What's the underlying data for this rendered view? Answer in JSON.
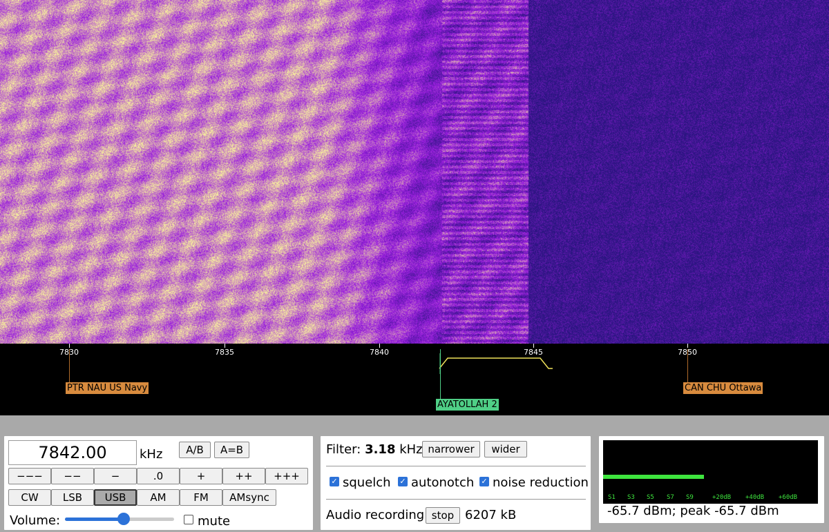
{
  "waterfall": {
    "colors": {
      "hot": "#f7ef9c",
      "mid": "#9c1ee0",
      "cold": "#2a1580",
      "background": "#1c0f6e"
    }
  },
  "scale": {
    "ticks": [
      {
        "label": "7830"
      },
      {
        "label": "7835"
      },
      {
        "label": "7840"
      },
      {
        "label": "7845"
      },
      {
        "label": "7850"
      }
    ],
    "markers": [
      {
        "label": "PTR NAU US Navy",
        "color": "orange"
      },
      {
        "label": "AYATOLLAH 2",
        "color": "green"
      },
      {
        "label": "CAN CHU Ottawa",
        "color": "orange"
      }
    ]
  },
  "tune": {
    "frequency": "7842.00",
    "unit": "kHz",
    "ab_label": "A/B",
    "aeqb_label": "A=B",
    "step_buttons": [
      "−−−",
      "−−",
      "−",
      ".0",
      "+",
      "++",
      "+++"
    ],
    "modes": [
      "CW",
      "LSB",
      "USB",
      "AM",
      "FM",
      "AMsync"
    ],
    "active_mode": "USB",
    "volume_label": "Volume:",
    "volume_level": 0.54,
    "mute_label": "mute"
  },
  "filter": {
    "label": "Filter:",
    "value": "3.18",
    "unit": "kHz",
    "narrower_label": "narrower",
    "wider_label": "wider",
    "squelch_label": "squelch",
    "autonotch_label": "autonotch",
    "noise_reduction_label": "noise reduction",
    "recording_label": "Audio recording",
    "stop_label": "stop",
    "recording_size": "6207 kB"
  },
  "smeter": {
    "scale_labels": [
      "S1",
      "S3",
      "S5",
      "S7",
      "S9",
      "+20dB",
      "+40dB",
      "+60dB"
    ],
    "level_fraction": 0.47,
    "reading": "-65.7 dBm; peak  -65.7 dBm",
    "bar_color": "#3ee43e"
  }
}
